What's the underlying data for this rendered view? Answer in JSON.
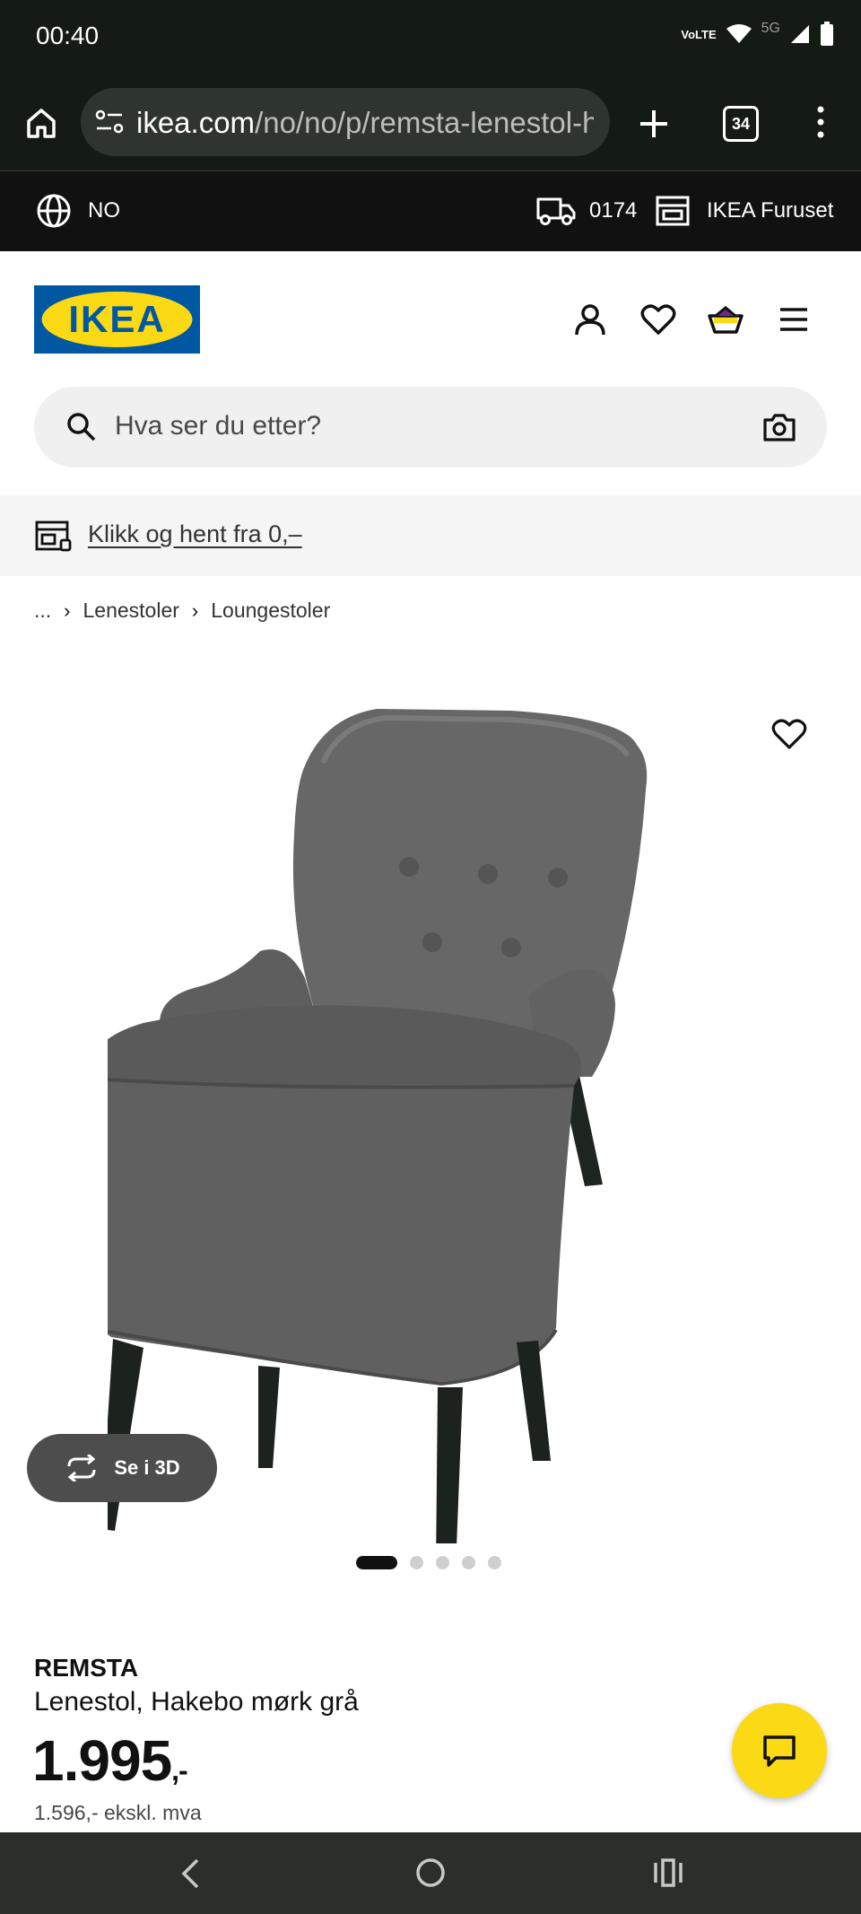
{
  "status_bar": {
    "time": "00:40",
    "network": "5G",
    "volte_label": "VoLTE"
  },
  "browser": {
    "url_host": "ikea.com",
    "url_path": "/no/no/p/remsta-lenestol-hakebo-mork-gra",
    "tab_count": "34",
    "icons": [
      "home-icon",
      "site-settings-icon",
      "new-tab-icon",
      "tab-switcher-icon",
      "more-icon"
    ]
  },
  "top_strip": {
    "country": "NO",
    "postcode": "0174",
    "store": "IKEA Furuset"
  },
  "header": {
    "logo_text": "IKEA",
    "icons": [
      "account-icon",
      "wishlist-icon",
      "cart-icon",
      "menu-icon"
    ]
  },
  "search": {
    "placeholder": "Hva ser du etter?"
  },
  "promo": {
    "text": "Klikk og hent fra 0,–"
  },
  "breadcrumb": {
    "ellipsis": "...",
    "items": [
      "Lenestoler",
      "Loungestoler"
    ]
  },
  "gallery": {
    "view3d_label": "Se i 3D",
    "image_count": 5,
    "active_index": 0
  },
  "product": {
    "name": "REMSTA",
    "description": "Lenestol, Hakebo mørk grå",
    "price": "1.995",
    "price_suffix": ",-",
    "price_ex_vat": "1.596,- ekskl. mva"
  },
  "colors": {
    "ikea_blue": "#0058a3",
    "ikea_yellow": "#fbd914",
    "dark_bar": "#111111"
  }
}
